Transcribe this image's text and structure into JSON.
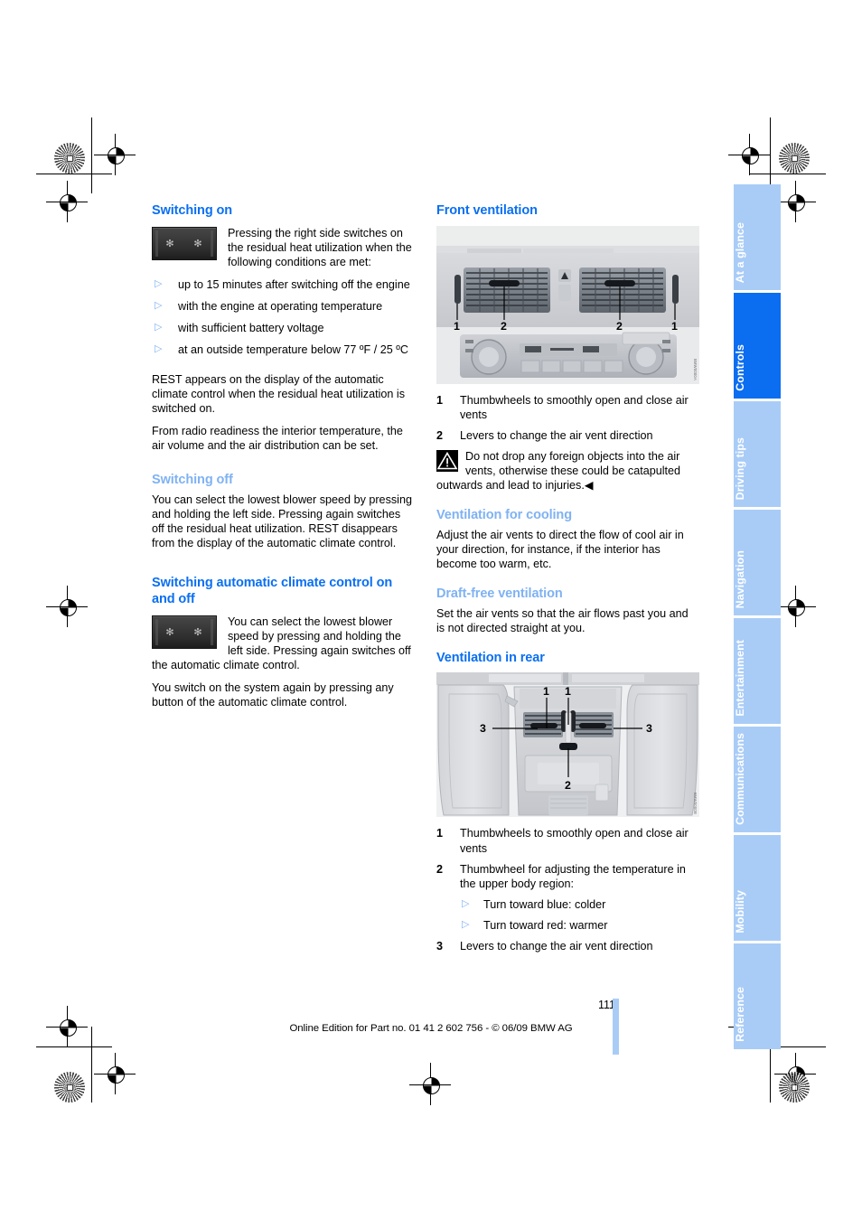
{
  "page": {
    "number": "111",
    "imprint": "Online Edition for Part no. 01 41 2 602 756 - © 06/09 BMW AG"
  },
  "left_column": {
    "heading_switching_on": "Switching on",
    "switch_on_intro": "Pressing the right side switches on the residual heat utilization when the following conditions are met:",
    "conditions": [
      "up to 15 minutes after switching off the engine",
      "with the engine at operating temperature",
      "with sufficient battery voltage",
      "at an outside temperature below 77 ºF / 25 ºC"
    ],
    "rest_paragraph": "REST appears on the display of the automatic climate control when the residual heat utilization is switched on.",
    "radio_paragraph": "From radio readiness the interior temperature, the air volume and the air distribution can be set.",
    "heading_switching_off": "Switching off",
    "switch_off_paragraph": "You can select the lowest blower speed by pressing and holding the left side. Pressing again switches off the residual heat utilization. REST disappears from the display of the automatic climate control.",
    "heading_auto_on_off": "Switching automatic climate control on and off",
    "auto_figure_paragraph": "You can select the lowest blower speed by pressing and holding the left side. Pressing again switches off the automatic climate control.",
    "auto_switch_on_paragraph": "You switch on the system again by pressing any button of the automatic climate control.",
    "button_graphic_icons": [
      "blower-fan-icon",
      "blower-fan-icon"
    ]
  },
  "right_column": {
    "heading_front_ventilation": "Front ventilation",
    "front_figure": {
      "name": "front-dashboard-air-vents-illustration",
      "callouts": [
        "1",
        "2",
        "2",
        "1"
      ]
    },
    "front_legend": [
      {
        "num": "1",
        "text": "Thumbwheels to smoothly open and close air vents"
      },
      {
        "num": "2",
        "text": "Levers to change the air vent direction"
      }
    ],
    "warning": {
      "icon": "warning-triangle-icon",
      "text": "Do not drop any foreign objects into the air vents, otherwise these could be catapulted outwards and lead to injuries.",
      "end_marker": "◀"
    },
    "heading_cooling": "Ventilation for cooling",
    "cooling_paragraph": "Adjust the air vents to direct the flow of cool air in your direction, for instance, if the interior has become too warm, etc.",
    "heading_draft_free": "Draft-free ventilation",
    "draft_free_paragraph": "Set the air vents so that the air flows past you and is not directed straight at you.",
    "heading_rear": "Ventilation in rear",
    "rear_figure": {
      "name": "rear-console-air-vents-illustration",
      "callouts": [
        "1",
        "1",
        "3",
        "3",
        "2"
      ]
    },
    "rear_legend": [
      {
        "num": "1",
        "text": "Thumbwheels to smoothly open and close air vents"
      },
      {
        "num": "2",
        "text": "Thumbwheel for adjusting the temperature in the upper body region:",
        "sub": [
          "Turn toward blue: colder",
          "Turn toward red: warmer"
        ]
      },
      {
        "num": "3",
        "text": "Levers to change the air vent direction"
      }
    ]
  },
  "sidebar": {
    "tabs": [
      {
        "label": "At a glance",
        "active": false
      },
      {
        "label": "Controls",
        "active": true
      },
      {
        "label": "Driving tips",
        "active": false
      },
      {
        "label": "Navigation",
        "active": false
      },
      {
        "label": "Entertainment",
        "active": false
      },
      {
        "label": "Communications",
        "active": false
      },
      {
        "label": "Mobility",
        "active": false
      },
      {
        "label": "Reference",
        "active": false
      }
    ]
  },
  "colors": {
    "heading_primary": "#0a6ff2",
    "heading_secondary": "#7fb2f3",
    "tab_inactive": "#a9ccf7",
    "tab_active": "#0b6df0",
    "figure_bg": "#e9eaec"
  }
}
